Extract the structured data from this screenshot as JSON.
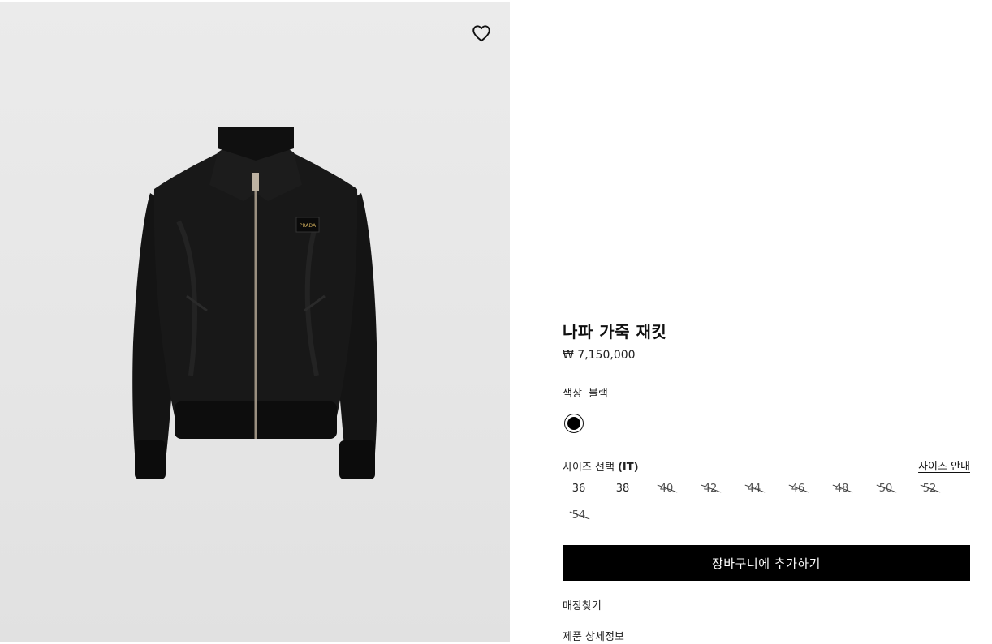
{
  "product": {
    "name": "나파 가죽 재킷",
    "price": "₩ 7,150,000",
    "color_label": "색상",
    "color_value": "블랙",
    "swatch_color": "#000000"
  },
  "sizes": {
    "label": "사이즈 선택",
    "unit": "(IT)",
    "guide_label": "사이즈 안내",
    "options": [
      {
        "label": "36",
        "available": true
      },
      {
        "label": "38",
        "available": true
      },
      {
        "label": "40",
        "available": false
      },
      {
        "label": "42",
        "available": false
      },
      {
        "label": "44",
        "available": false
      },
      {
        "label": "46",
        "available": false
      },
      {
        "label": "48",
        "available": false
      },
      {
        "label": "50",
        "available": false
      },
      {
        "label": "52",
        "available": false
      },
      {
        "label": "54",
        "available": false
      }
    ]
  },
  "actions": {
    "add_to_cart": "장바구니에 추가하기",
    "find_store": "매장찾기",
    "product_details": "제품 상세정보"
  },
  "icons": {
    "wishlist": "heart-outline-icon"
  },
  "logo_text": "PRADA"
}
